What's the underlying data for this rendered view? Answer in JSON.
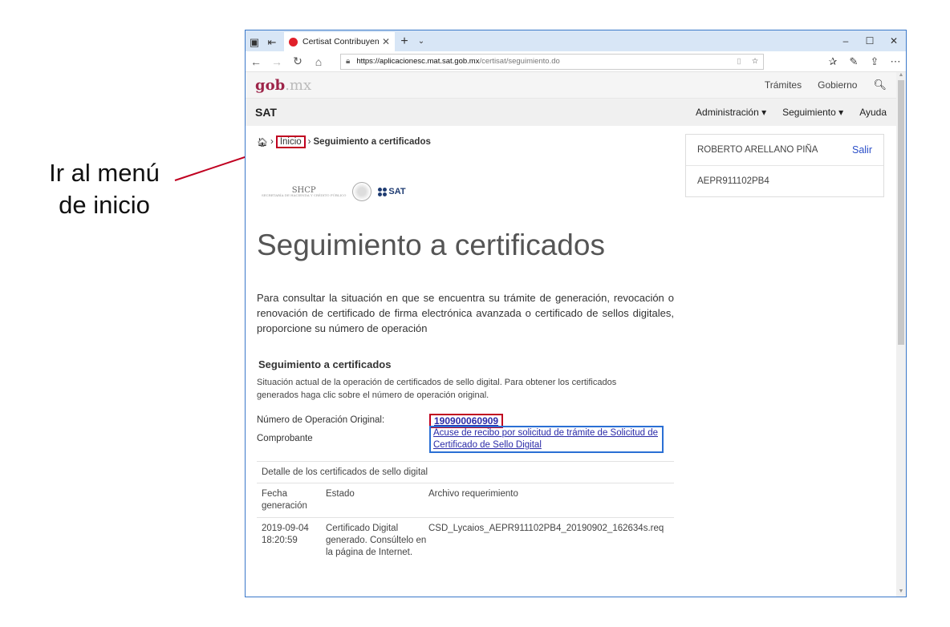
{
  "annotation": {
    "line1": "Ir al menú",
    "line2": "de inicio"
  },
  "browser": {
    "tab_title": "Certisat Contribuyente",
    "url_host": "https://aplicacionesc.mat.sat.gob.mx",
    "url_path": "/certisat/seguimiento.do"
  },
  "gob": {
    "logo_main": "gob",
    "logo_suffix": ".mx",
    "links": [
      "Trámites",
      "Gobierno"
    ]
  },
  "sat": {
    "title": "SAT",
    "menu": [
      "Administración ▾",
      "Seguimiento ▾",
      "Ayuda"
    ]
  },
  "breadcrumb": {
    "separator": "›",
    "inicio": "Inicio",
    "current": "Seguimiento a certificados"
  },
  "logos": {
    "shcp": "SHCP",
    "shcp_sub": "SECRETARÍA DE HACIENDA Y CRÉDITO PÚBLICO",
    "sat": "SAT"
  },
  "user": {
    "name": "ROBERTO ARELLANO PIÑA",
    "logout": "Salir",
    "rfc": "AEPR911102PB4"
  },
  "page": {
    "title": "Seguimiento a certificados",
    "intro": "Para consultar la situación en que se encuentra su trámite de generación, revocación o renovación de certificado de firma electrónica avanzada o certificado de sellos digitales, proporcione su número de operación"
  },
  "section": {
    "title": "Seguimiento a certificados",
    "description": "Situación actual de la operación de certificados de sello digital. Para obtener los certificados generados haga clic sobre el número de operación original.",
    "op_label": "Número de Operación Original:",
    "op_number": "190900060909",
    "comprobante_label": "Comprobante",
    "comprobante_link": "Acuse de recibo por solicitud de trámite de Solicitud de Certificado de Sello Digital"
  },
  "table": {
    "caption": "Detalle de los certificados de sello digital",
    "headers": [
      "Fecha generación",
      "Estado",
      "Archivo requerimiento"
    ],
    "rows": [
      [
        "2019-09-04 18:20:59",
        "Certificado Digital generado. Consúltelo en la página de Internet.",
        "CSD_Lycaios_AEPR911102PB4_20190902_162634s.req"
      ]
    ]
  }
}
